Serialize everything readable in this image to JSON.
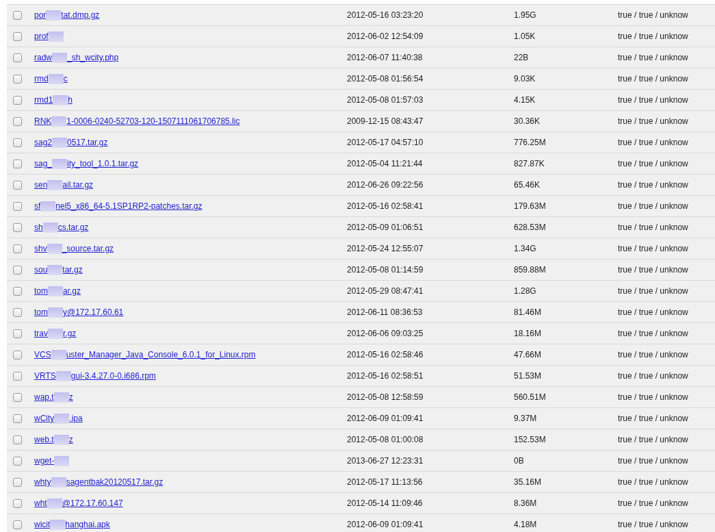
{
  "rows": [
    {
      "checked": false,
      "name_start": "por",
      "name_end": "tat.dmp.gz",
      "modified": "2012-05-16 03:23:20",
      "size": "1.95G",
      "status": "true / true / unknow"
    },
    {
      "checked": false,
      "name_start": "prof",
      "modified": "2012-06-02 12:54:09",
      "size": "1.05K",
      "status": "true / true / unknow"
    },
    {
      "checked": false,
      "name_start": "radw",
      "name_end": "_sh_wcity.php",
      "modified": "2012-06-07 11:40:38",
      "size": "22B",
      "status": "true / true / unknow"
    },
    {
      "checked": false,
      "name_start": "rmd",
      "name_end": "c",
      "modified": "2012-05-08 01:56:54",
      "size": "9.03K",
      "status": "true / true / unknow"
    },
    {
      "checked": false,
      "name_start": "rmd1",
      "name_end": "h",
      "modified": "2012-05-08 01:57:03",
      "size": "4.15K",
      "status": "true / true / unknow"
    },
    {
      "checked": false,
      "name_start": "RNK",
      "name_end": "1-0006-0240-52703-120-1507111061706785.lic",
      "modified": "2009-12-15 08:43:47",
      "size": "30.36K",
      "status": "true / true / unknow"
    },
    {
      "checked": false,
      "name_start": "sag2",
      "name_end": "0517.tar.gz",
      "modified": "2012-05-17 04:57:10",
      "size": "776.25M",
      "status": "true / true / unknow"
    },
    {
      "checked": false,
      "name_start": "sag_",
      "name_end": "ity_tool_1.0.1.tar.gz",
      "modified": "2012-05-04 11:21:44",
      "size": "827.87K",
      "status": "true / true / unknow"
    },
    {
      "checked": false,
      "name_start": "sen",
      "name_end": "ail.tar.gz",
      "modified": "2012-06-26 09:22:56",
      "size": "65.46K",
      "status": "true / true / unknow"
    },
    {
      "checked": false,
      "name_start": "sf",
      "name_end": "nel5_x86_64-5.1SP1RP2-patches.tar.gz",
      "modified": "2012-05-16 02:58:41",
      "size": "179.63M",
      "status": "true / true / unknow"
    },
    {
      "checked": false,
      "name_start": "sh",
      "name_end": "cs.tar.gz",
      "modified": "2012-05-09 01:06:51",
      "size": "628.53M",
      "status": "true / true / unknow"
    },
    {
      "checked": false,
      "name_start": "shv",
      "name_end": "_source.tar.gz",
      "modified": "2012-05-24 12:55:07",
      "size": "1.34G",
      "status": "true / true / unknow"
    },
    {
      "checked": false,
      "name_start": "sou",
      "name_end": "tar.gz",
      "modified": "2012-05-08 01:14:59",
      "size": "859.88M",
      "status": "true / true / unknow"
    },
    {
      "checked": false,
      "name_start": "tom",
      "name_end": "ar.gz",
      "modified": "2012-05-29 08:47:41",
      "size": "1.28G",
      "status": "true / true / unknow"
    },
    {
      "checked": false,
      "name_start": "tom",
      "name_end": "y@172.17.60.61",
      "modified": "2012-06-11 08:36:53",
      "size": "81.46M",
      "status": "true / true / unknow"
    },
    {
      "checked": false,
      "name_start": "trav",
      "name_end": "r.gz",
      "modified": "2012-06-06 09:03:25",
      "size": "18.16M",
      "status": "true / true / unknow"
    },
    {
      "checked": false,
      "name_start": "VCS",
      "name_end": "uster_Manager_Java_Console_6.0.1_for_Linux.rpm",
      "modified": "2012-05-16 02:58:46",
      "size": "47.66M",
      "status": "true / true / unknow"
    },
    {
      "checked": false,
      "name_start": "VRTS",
      "name_end": "gui-3.4.27.0-0.i686.rpm",
      "modified": "2012-05-16 02:58:51",
      "size": "51.53M",
      "status": "true / true / unknow"
    },
    {
      "checked": false,
      "name_start": "wap.t",
      "name_end": "z",
      "modified": "2012-05-08 12:58:59",
      "size": "560.51M",
      "status": "true / true / unknow"
    },
    {
      "checked": false,
      "name_start": "wCity",
      "name_end": ".ipa",
      "modified": "2012-06-09 01:09:41",
      "size": "9.37M",
      "status": "true / true / unknow"
    },
    {
      "checked": false,
      "name_start": "web.t",
      "name_end": "z",
      "modified": "2012-05-08 01:00:08",
      "size": "152.53M",
      "status": "true / true / unknow"
    },
    {
      "checked": false,
      "name_start": "wget-",
      "modified": "2013-06-27 12:23:31",
      "size": "0B",
      "status": "true / true / unknow"
    },
    {
      "checked": false,
      "name_start": "whty",
      "name_end": "sagentbak20120517.tar.gz",
      "modified": "2012-05-17 11:13:56",
      "size": "35.16M",
      "status": "true / true / unknow"
    },
    {
      "checked": false,
      "name_start": "wht",
      "name_end": "@172.17.60.147",
      "modified": "2012-05-14 11:09:46",
      "size": "8.36M",
      "status": "true / true / unknow"
    },
    {
      "checked": false,
      "name_start": "wicit",
      "name_end": "hanghai.apk",
      "modified": "2012-06-09 01:09:41",
      "size": "4.18M",
      "status": "true / true / unknow"
    }
  ]
}
